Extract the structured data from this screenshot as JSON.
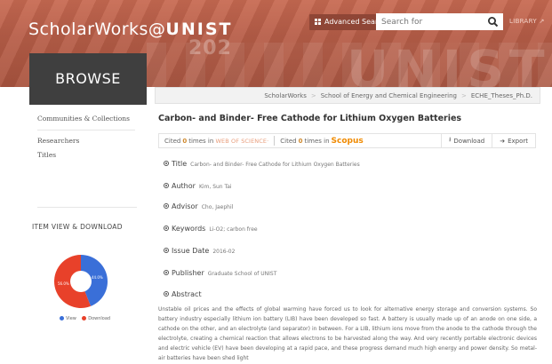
{
  "header": {
    "brand_prefix": "ScholarWorks@",
    "brand_uni": "UNIST",
    "banner_number": "202",
    "banner_text": "UNIST",
    "advanced_search_label": "Advanced Search",
    "search_placeholder": "Search for",
    "library_label": "LIBRARY"
  },
  "browse_label": "BROWSE",
  "breadcrumb": [
    "ScholarWorks",
    "School of Energy and Chemical Engineering",
    "ECHE_Theses_Ph.D."
  ],
  "sidebar": {
    "items": [
      "Communities & Collections",
      "Researchers",
      "Titles"
    ],
    "item_view_title": "ITEM VIEW & DOWNLOAD",
    "pie": {
      "view_pct": "44.0%",
      "download_pct": "56.0%",
      "view_fraction": 0.44,
      "view_color": "#3a6fd8",
      "download_color": "#e8412a"
    },
    "legend": {
      "view": "View",
      "download": "Download"
    }
  },
  "main": {
    "title": "Carbon- and Binder- Free Cathode for Lithium Oxygen Batteries",
    "cite": {
      "cited_prefix": "Cited",
      "count_wos": "0",
      "times_in": "times in",
      "wos_label": "WEB OF SCIENCE·",
      "count_scopus": "0",
      "scopus_label": "Scopus",
      "download_label": "Download",
      "export_label": "Export"
    },
    "fields": [
      {
        "label": "Title",
        "value": "Carbon- and Binder- Free Cathode for Lithium Oxygen Batteries"
      },
      {
        "label": "Author",
        "value": "Kim, Sun Tai"
      },
      {
        "label": "Advisor",
        "value": "Cho, Jaephil"
      },
      {
        "label": "Keywords",
        "value": "Li-O2; carbon free"
      },
      {
        "label": "Issue Date",
        "value": "2016-02"
      },
      {
        "label": "Publisher",
        "value": "Graduate School of UNIST"
      },
      {
        "label": "Abstract",
        "value": ""
      }
    ],
    "abstract_text": "Unstable oil prices and the effects of global warming have forced us to look for alternative energy storage and conversion systems. So battery industry especially lithium ion battery (LIB) have been developed so fast. A battery is usually made up of an anode on one side, a cathode on the other, and an electrolyte (and separator) in between. For a LIB, lithium ions move from the anode to the cathode through the electrolyte, creating a chemical reaction that allows electrons to be harvested along the way. And very recently portable electronic devices and electric vehicle (EV) have been developing at a rapid pace, and these progress demand much high energy and power density. So metal-air batteries have been shed light"
  }
}
